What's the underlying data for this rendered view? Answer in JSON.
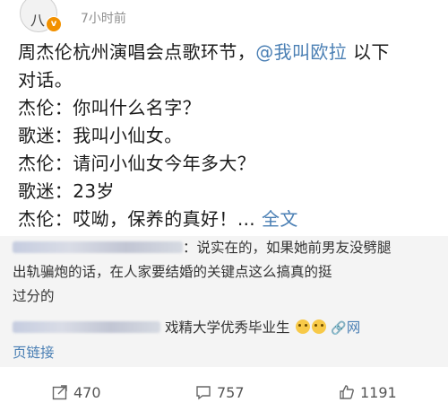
{
  "header": {
    "time": "7小时前"
  },
  "post": {
    "line1_a": "周杰伦杭州演唱会点歌环节，",
    "mention": "@我叫欧拉",
    "line1_b": " 以下",
    "line2": "对话。",
    "line3": "杰伦：你叫什么名字？",
    "line4": "歌迷：我叫小仙女。",
    "line5": "杰伦：请问小仙女今年多大？",
    "line6": "歌迷：23岁",
    "line7": "杰伦：哎呦，保养的真好！…",
    "full_text_link": "全文"
  },
  "comment": {
    "line1": "：说实在的，如果她前男友没劈腿",
    "line2": "出轨骗炮的话，在人家要结婚的关键点这么搞真的挺",
    "line3": "过分的",
    "line4": "戏精大学优秀毕业生",
    "link_label_a": "网",
    "link_label_b": "页链接"
  },
  "actions": {
    "repost_count": "470",
    "comment_count": "757",
    "like_count": "1191"
  },
  "colors": {
    "link": "#4a7fb4",
    "quote_bg": "#f4f4f4",
    "verified_badge": "#f29100"
  },
  "icons": [
    "avatar",
    "verified-badge-icon",
    "emoji-icon",
    "link-icon",
    "repost-icon",
    "comment-icon",
    "like-icon"
  ]
}
